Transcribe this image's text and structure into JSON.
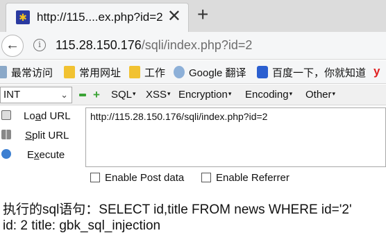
{
  "tab": {
    "title": "http://115....ex.php?id=2",
    "close_glyph": "✕",
    "new_tab_glyph": "+"
  },
  "nav": {
    "back_glyph": "←",
    "url_host": "115.28.150.176",
    "url_path": "/sqli/index.php?id=2"
  },
  "bookmarks": [
    {
      "label": "最常访问",
      "icon": "bookmark-icon"
    },
    {
      "label": "常用网址",
      "icon": "folder-icon"
    },
    {
      "label": "工作",
      "icon": "folder-icon"
    },
    {
      "label": "Google 翻译",
      "icon": "globe-icon"
    },
    {
      "label": "百度一下，你就知道",
      "icon": "paw-icon"
    }
  ],
  "bookmarks_overflow": "y",
  "hackbar": {
    "select_value": "INT",
    "menus": [
      "SQL",
      "XSS",
      "Encryption",
      "Encoding",
      "Other"
    ],
    "actions": {
      "load_prefix": "Lo",
      "load_key": "a",
      "load_rest": "d URL",
      "split_prefix": "",
      "split_key": "S",
      "split_rest": "plit URL",
      "exec_prefix": "E",
      "exec_key": "x",
      "exec_rest": "ecute"
    },
    "url_value": "http://115.28.150.176/sqli/index.php?id=2",
    "enable_post": "Enable Post data",
    "enable_referrer": "Enable Referrer"
  },
  "page": {
    "query_line": "执行的sql语句：SELECT id,title FROM news WHERE id='2'",
    "result_line": "id: 2 title: gbk_sql_injection"
  },
  "colors": {
    "accent_green": "#3aa335",
    "favicon_bg": "#2a3aa0"
  }
}
